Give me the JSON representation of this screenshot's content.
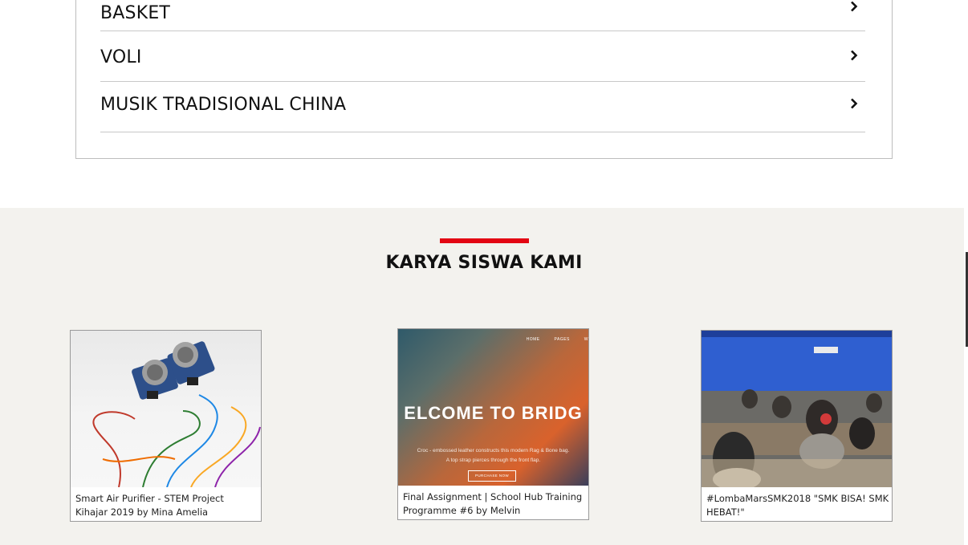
{
  "accordion": {
    "items": [
      {
        "label": "BASKET"
      },
      {
        "label": "VOLI"
      },
      {
        "label": "MUSIK TRADISIONAL CHINA"
      }
    ]
  },
  "gallery": {
    "title": "KARYA SISWA KAMI",
    "accent_color": "#e30613",
    "cards": [
      {
        "caption": "Smart Air Purifier - STEM Project Kihajar 2019 by Mina Amelia",
        "icon": "video-thumbnail"
      },
      {
        "caption": "Final Assignment | School Hub Training Programme #6 by Melvin",
        "icon": "video-thumbnail",
        "thumb": {
          "nav": [
            "HOME",
            "PAGES",
            "W"
          ],
          "headline": "ELCOME TO BRIDG",
          "sub_lines": [
            "Croc - embossed leather constructs this modern Rag & Bone bag.",
            "A top strap pierces through the front flap."
          ],
          "button": "PURCHASE NOW"
        }
      },
      {
        "caption": "#LombaMarsSMK2018 \"SMK BISA! SMK HEBAT!\"",
        "icon": "video-thumbnail"
      }
    ]
  }
}
